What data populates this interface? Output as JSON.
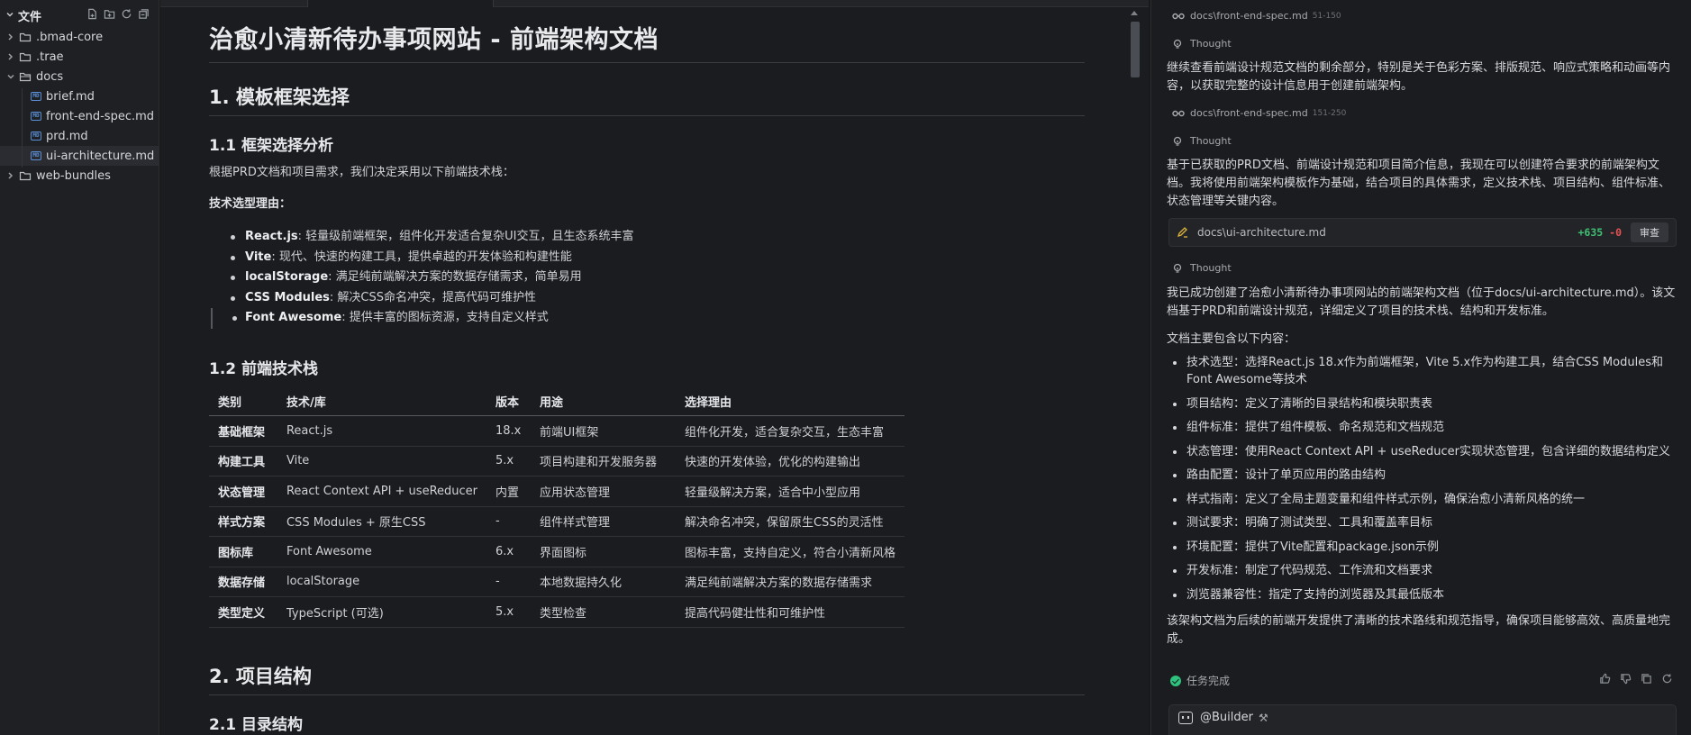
{
  "explorer": {
    "title": "文件",
    "actions": [
      "new-file-icon",
      "new-folder-icon",
      "refresh-icon",
      "collapse-all-icon"
    ],
    "items": [
      {
        "name": ".bmad-core",
        "type": "folder",
        "expanded": false
      },
      {
        "name": ".trae",
        "type": "folder",
        "expanded": false
      },
      {
        "name": "docs",
        "type": "folder",
        "expanded": true
      },
      {
        "name": "brief.md",
        "type": "file"
      },
      {
        "name": "front-end-spec.md",
        "type": "file"
      },
      {
        "name": "prd.md",
        "type": "file"
      },
      {
        "name": "ui-architecture.md",
        "type": "file",
        "selected": true
      },
      {
        "name": "web-bundles",
        "type": "folder",
        "expanded": false
      }
    ]
  },
  "doc": {
    "h1": "治愈小清新待办事项网站 - 前端架构文档",
    "s1_title": "1. 模板框架选择",
    "s11_title": "1.1 框架选择分析",
    "s11_intro": "根据PRD文档和项目需求，我们决定采用以下前端技术栈：",
    "s11_reason_label": "技术选型理由：",
    "reasons": [
      {
        "name": "React.js",
        "desc": ": 轻量级前端框架，组件化开发适合复杂UI交互，且生态系统丰富"
      },
      {
        "name": "Vite",
        "desc": ": 现代、快速的构建工具，提供卓越的开发体验和构建性能"
      },
      {
        "name": "localStorage",
        "desc": ": 满足纯前端解决方案的数据存储需求，简单易用"
      },
      {
        "name": "CSS Modules",
        "desc": ": 解决CSS命名冲突，提高代码可维护性"
      },
      {
        "name": "Font Awesome",
        "desc": ": 提供丰富的图标资源，支持自定义样式"
      }
    ],
    "s12_title": "1.2 前端技术栈",
    "table": {
      "headers": [
        "类别",
        "技术/库",
        "版本",
        "用途",
        "选择理由"
      ],
      "rows": [
        [
          "基础框架",
          "React.js",
          "18.x",
          "前端UI框架",
          "组件化开发，适合复杂交互，生态丰富"
        ],
        [
          "构建工具",
          "Vite",
          "5.x",
          "项目构建和开发服务器",
          "快速的开发体验，优化的构建输出"
        ],
        [
          "状态管理",
          "React Context API + useReducer",
          "内置",
          "应用状态管理",
          "轻量级解决方案，适合中小型应用"
        ],
        [
          "样式方案",
          "CSS Modules + 原生CSS",
          "-",
          "组件样式管理",
          "解决命名冲突，保留原生CSS的灵活性"
        ],
        [
          "图标库",
          "Font Awesome",
          "6.x",
          "界面图标",
          "图标丰富，支持自定义，符合小清新风格"
        ],
        [
          "数据存储",
          "localStorage",
          "-",
          "本地数据持久化",
          "满足纯前端解决方案的数据存储需求"
        ],
        [
          "类型定义",
          "TypeScript (可选)",
          "5.x",
          "类型检查",
          "提高代码健壮性和可维护性"
        ]
      ]
    },
    "s2_title": "2. 项目结构",
    "s21_title": "2.1 目录结构"
  },
  "chat": {
    "file1": {
      "path": "docs\\front-end-spec.md",
      "range": "51-150"
    },
    "thought_label": "Thought",
    "text1": "继续查看前端设计规范文档的剩余部分，特别是关于色彩方案、排版规范、响应式策略和动画等内容，以获取完整的设计信息用于创建前端架构。",
    "file2": {
      "path": "docs\\front-end-spec.md",
      "range": "151-250"
    },
    "text2": "基于已获取的PRD文档、前端设计规范和项目简介信息，我现在可以创建符合要求的前端架构文档。我将使用前端架构模板作为基础，结合项目的具体需求，定义技术栈、项目结构、组件标准、状态管理等关键内容。",
    "edit_card": {
      "file": "docs\\ui-architecture.md",
      "plus": "+635",
      "minus": "-0",
      "review": "审查"
    },
    "text3": "我已成功创建了治愈小清新待办事项网站的前端架构文档（位于docs/ui-architecture.md）。该文档基于PRD和前端设计规范，详细定义了项目的技术栈、结构和开发标准。",
    "text4": "文档主要包含以下内容：",
    "summary": [
      "技术选型：选择React.js 18.x作为前端框架，Vite 5.x作为构建工具，结合CSS Modules和Font Awesome等技术",
      "项目结构：定义了清晰的目录结构和模块职责表",
      "组件标准：提供了组件模板、命名规范和文档规范",
      "状态管理：使用React Context API + useReducer实现状态管理，包含详细的数据结构定义",
      "路由配置：设计了单页应用的路由结构",
      "样式指南：定义了全局主题变量和组件样式示例，确保治愈小清新风格的统一",
      "测试要求：明确了测试类型、工具和覆盖率目标",
      "环境配置：提供了Vite配置和package.json示例",
      "开发标准：制定了代码规范、工作流和文档要求",
      "浏览器兼容性：指定了支持的浏览器及其最低版本"
    ],
    "text5": "该架构文档为后续的前端开发提供了清晰的技术路线和规范指导，确保项目能够高效、高质量地完成。",
    "done_label": "任务完成",
    "agent_name": "@Builder",
    "colors": {
      "accent_green": "#2ec27e",
      "diff_plus": "#3fbf73",
      "diff_minus": "#e55353"
    }
  }
}
